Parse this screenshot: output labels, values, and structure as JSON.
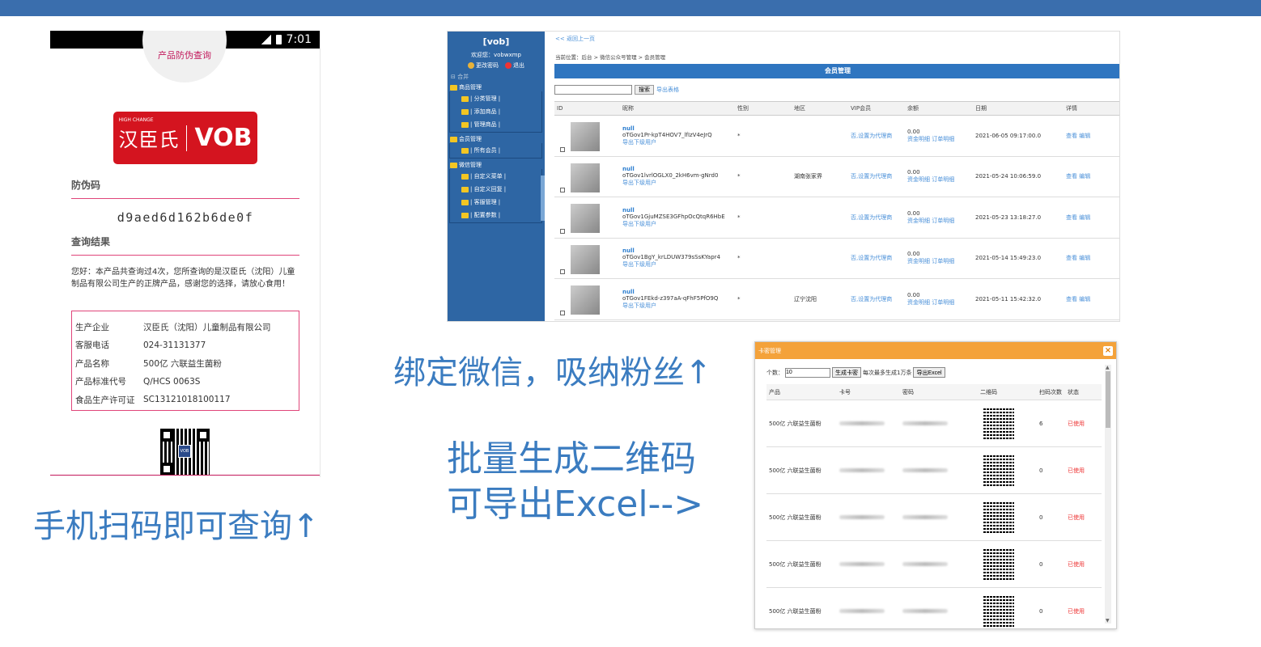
{
  "phone": {
    "time": "7:01",
    "header": "产品防伪查询",
    "logo": {
      "sup": "HIGH CHANGE",
      "zh": "汉臣氏",
      "en": "VOB"
    },
    "code_label": "防伪码",
    "code": "d9aed6d162b6de0f",
    "result_label": "查询结果",
    "message": "您好：本产品共查询过4次，您所查询的是汉臣氏（沈阳）儿童制品有限公司生产的正牌产品，感谢您的选择，请放心食用！",
    "info": [
      {
        "k": "生产企业",
        "v": "汉臣氏（沈阳）儿童制品有限公司"
      },
      {
        "k": "客服电话",
        "v": "024-31131377"
      },
      {
        "k": "产品名称",
        "v": "500亿 六联益生菌粉"
      },
      {
        "k": "产品标准代号",
        "v": "Q/HCS 0063S"
      },
      {
        "k": "食品生产许可证",
        "v": "SC13121018100117"
      }
    ],
    "qr_logo": "VOB"
  },
  "admin": {
    "title": "[vob]",
    "welcome": "欢迎您：vobwxmp",
    "change_pwd": "更改密码",
    "logout": "退出",
    "collapse": "合并",
    "groups": [
      {
        "name": "商品管理",
        "items": [
          "| 分类管理 |",
          "| 添加商品 |",
          "| 管理商品 |"
        ]
      },
      {
        "name": "会员管理",
        "items": [
          "| 所有会员 |"
        ]
      },
      {
        "name": "微信管理",
        "items": [
          "| 自定义菜单 |",
          "| 自定义回复 |",
          "| 客服管理 |",
          "| 配置参数 |"
        ]
      }
    ],
    "back": "<< 返回上一页",
    "breadcrumb": "当前位置：后台 > 微信公众号管理 > 会员管理",
    "panel_title": "会员管理",
    "search_btn": "搜索",
    "export_link": "导出表格",
    "headers": [
      "ID",
      "昵称",
      "性别",
      "地区",
      "VIP会员",
      "余额",
      "日期",
      "详情"
    ],
    "rows": [
      {
        "null": "null",
        "openid": "oTGov1Pr-kpT4HOV7_lfIzV4eJrQ",
        "export": "导出下级用户",
        "sex": "*",
        "area": "",
        "vip": "否,设置为代理商",
        "bal": "0.00",
        "bal_links": "资金明细 订单明细",
        "date": "2021-06-05 09:17:00.0",
        "det": "查看 编辑"
      },
      {
        "null": "null",
        "openid": "oTGov1lvrlOGLX0_2kH6vm-gNrd0",
        "export": "导出下级用户",
        "sex": "*",
        "area": "湖南张家界",
        "vip": "否,设置为代理商",
        "bal": "0.00",
        "bal_links": "资金明细 订单明细",
        "date": "2021-05-24 10:06:59.0",
        "det": "查看 编辑"
      },
      {
        "null": "null",
        "openid": "oTGov1GjuMZSE3GFhpOcQtqR6HbE",
        "export": "导出下级用户",
        "sex": "*",
        "area": "",
        "vip": "否,设置为代理商",
        "bal": "0.00",
        "bal_links": "资金明细 订单明细",
        "date": "2021-05-23 13:18:27.0",
        "det": "查看 编辑"
      },
      {
        "null": "null",
        "openid": "oTGov1BgY_krLDUW379sSsKYapr4",
        "export": "导出下级用户",
        "sex": "*",
        "area": "",
        "vip": "否,设置为代理商",
        "bal": "0.00",
        "bal_links": "资金明细 订单明细",
        "date": "2021-05-14 15:49:23.0",
        "det": "查看 编辑"
      },
      {
        "null": "null",
        "openid": "oTGov1FEkd-z397aA-qFhF5PfO9Q",
        "export": "导出下级用户",
        "sex": "*",
        "area": "辽宁沈阳",
        "vip": "否,设置为代理商",
        "bal": "0.00",
        "bal_links": "资金明细 订单明细",
        "date": "2021-05-11 15:42:32.0",
        "det": "查看 编辑"
      }
    ]
  },
  "dialog": {
    "title": "卡密管理",
    "close": "×",
    "count_label": "个数：",
    "count_value": "10",
    "gen_btn": "生成卡密",
    "hint": "每次最多生成1万条",
    "export_btn": "导出Excel",
    "headers": [
      "产品",
      "卡号",
      "密码",
      "二维码",
      "扫码次数",
      "状态"
    ],
    "rows": [
      {
        "prod": "500亿 六联益生菌粉",
        "scan": "6",
        "st": "已使用"
      },
      {
        "prod": "500亿 六联益生菌粉",
        "scan": "0",
        "st": "已使用"
      },
      {
        "prod": "500亿 六联益生菌粉",
        "scan": "0",
        "st": "已使用"
      },
      {
        "prod": "500亿 六联益生菌粉",
        "scan": "0",
        "st": "已使用"
      },
      {
        "prod": "500亿 六联益生菌粉",
        "scan": "0",
        "st": "已使用"
      }
    ]
  },
  "captions": {
    "cap1": "手机扫码即可查询↑",
    "cap2": "绑定微信，吸纳粉丝↑",
    "cap3a": "批量生成二维码",
    "cap3b": "可导出Excel-->"
  }
}
